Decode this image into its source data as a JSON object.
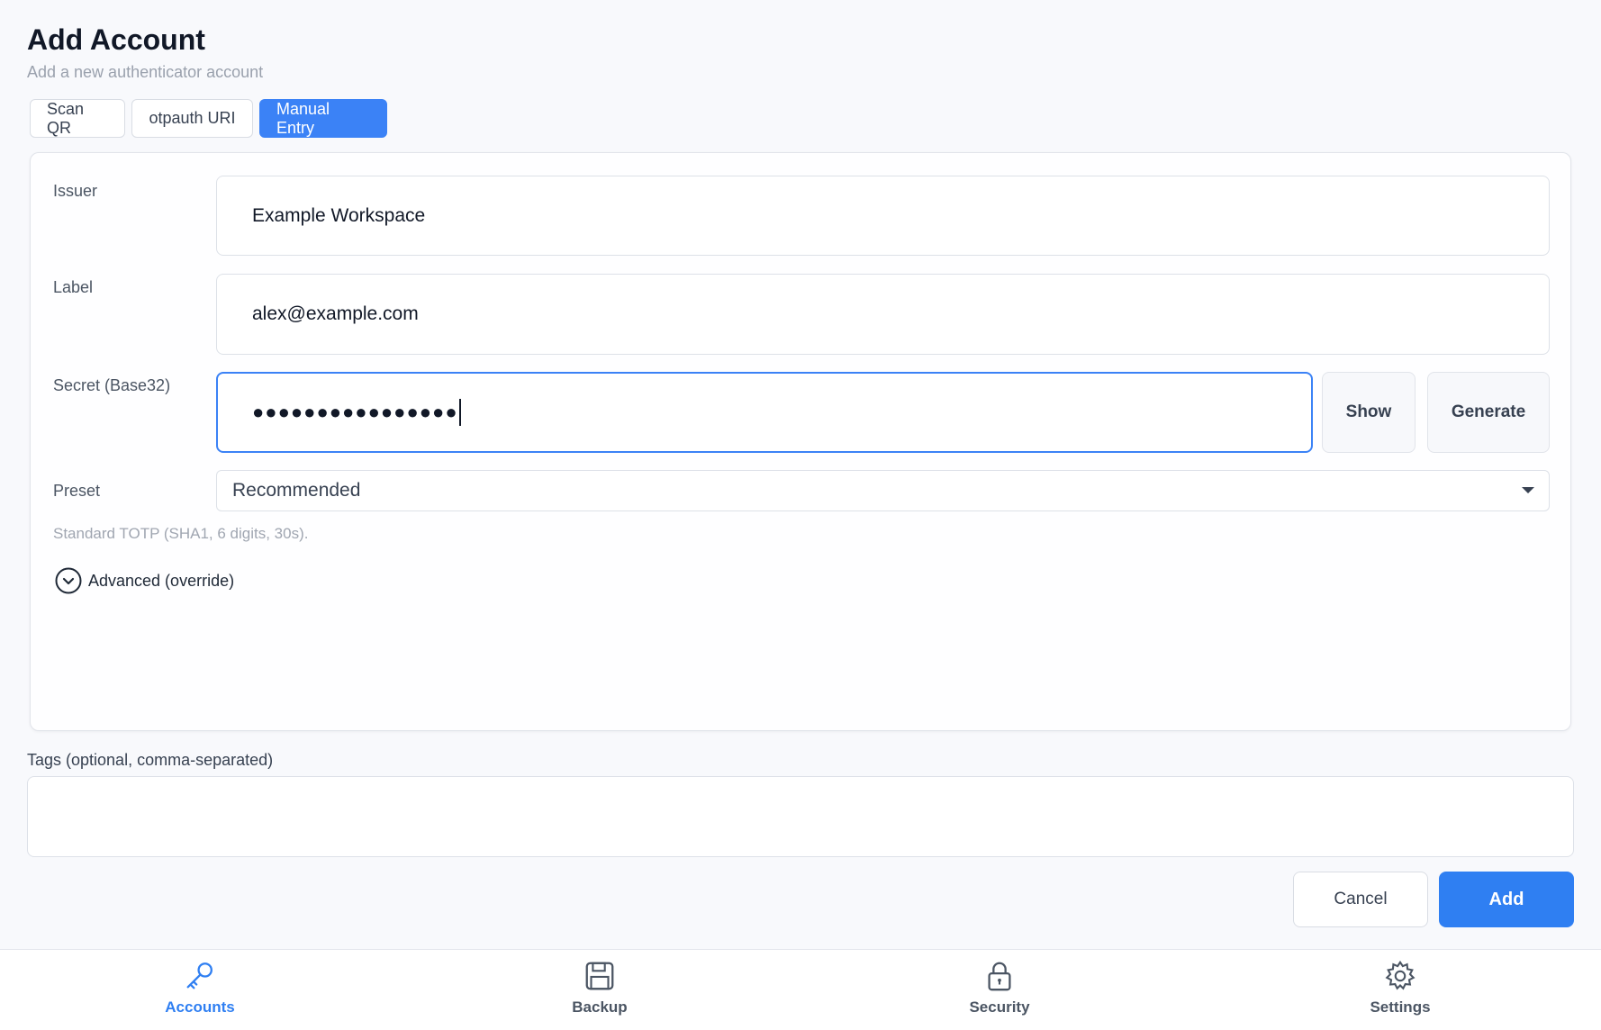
{
  "header": {
    "title": "Add Account",
    "subtitle": "Add a new authenticator account"
  },
  "tabs": [
    {
      "label": "Scan QR",
      "active": false
    },
    {
      "label": "otpauth URI",
      "active": false
    },
    {
      "label": "Manual Entry",
      "active": true
    }
  ],
  "form": {
    "issuer": {
      "label": "Issuer",
      "value": "Example Workspace"
    },
    "account_label": {
      "label": "Label",
      "value": "alex@example.com"
    },
    "secret": {
      "label": "Secret (Base32)",
      "masked_value": "●●●●●●●●●●●●●●●●",
      "show_label": "Show",
      "generate_label": "Generate"
    },
    "preset": {
      "label": "Preset",
      "selected": "Recommended",
      "hint": "Standard TOTP (SHA1, 6 digits, 30s)."
    },
    "advanced_label": "Advanced (override)"
  },
  "tags": {
    "label": "Tags (optional, comma-separated)",
    "value": ""
  },
  "actions": {
    "cancel_label": "Cancel",
    "add_label": "Add"
  },
  "nav": [
    {
      "label": "Accounts",
      "icon": "key-icon",
      "active": true
    },
    {
      "label": "Backup",
      "icon": "floppy-disk-icon",
      "active": false
    },
    {
      "label": "Security",
      "icon": "lock-icon",
      "active": false
    },
    {
      "label": "Settings",
      "icon": "gear-icon",
      "active": false
    }
  ],
  "colors": {
    "accent": "#3b82f6",
    "primary_button": "#2f7ff2",
    "background": "#f8f9fc"
  }
}
